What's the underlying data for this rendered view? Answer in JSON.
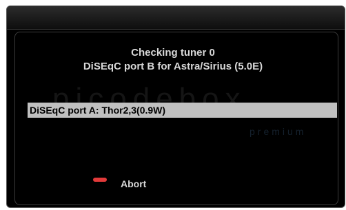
{
  "dialog": {
    "message_line1": "Checking tuner 0",
    "message_line2": "DiSEqC port B for Astra/Sirius (5.0E)"
  },
  "list": {
    "items": [
      {
        "label": "DiSEqC port A: Thor2,3(0.9W)",
        "selected": true
      }
    ]
  },
  "footer": {
    "abort_label": "Abort",
    "abort_key_color": "#e23a3a"
  },
  "watermark": {
    "logo_text": "picodebox",
    "logo_subtext": "premium"
  }
}
